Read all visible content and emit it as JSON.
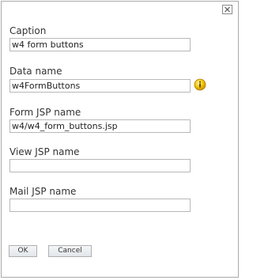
{
  "dialog": {
    "close_icon": "close-x-icon",
    "fields": {
      "caption": {
        "label": "Caption",
        "value": "w4 form buttons"
      },
      "data_name": {
        "label": "Data name",
        "value": "w4FormButtons",
        "info_icon": "info-icon",
        "info_color": "#e8b400"
      },
      "form_jsp": {
        "label": "Form JSP name",
        "value": "w4/w4_form_buttons.jsp"
      },
      "view_jsp": {
        "label": "View JSP name",
        "value": ""
      },
      "mail_jsp": {
        "label": "Mail JSP name",
        "value": ""
      }
    },
    "buttons": {
      "ok": "OK",
      "cancel": "Cancel"
    }
  }
}
